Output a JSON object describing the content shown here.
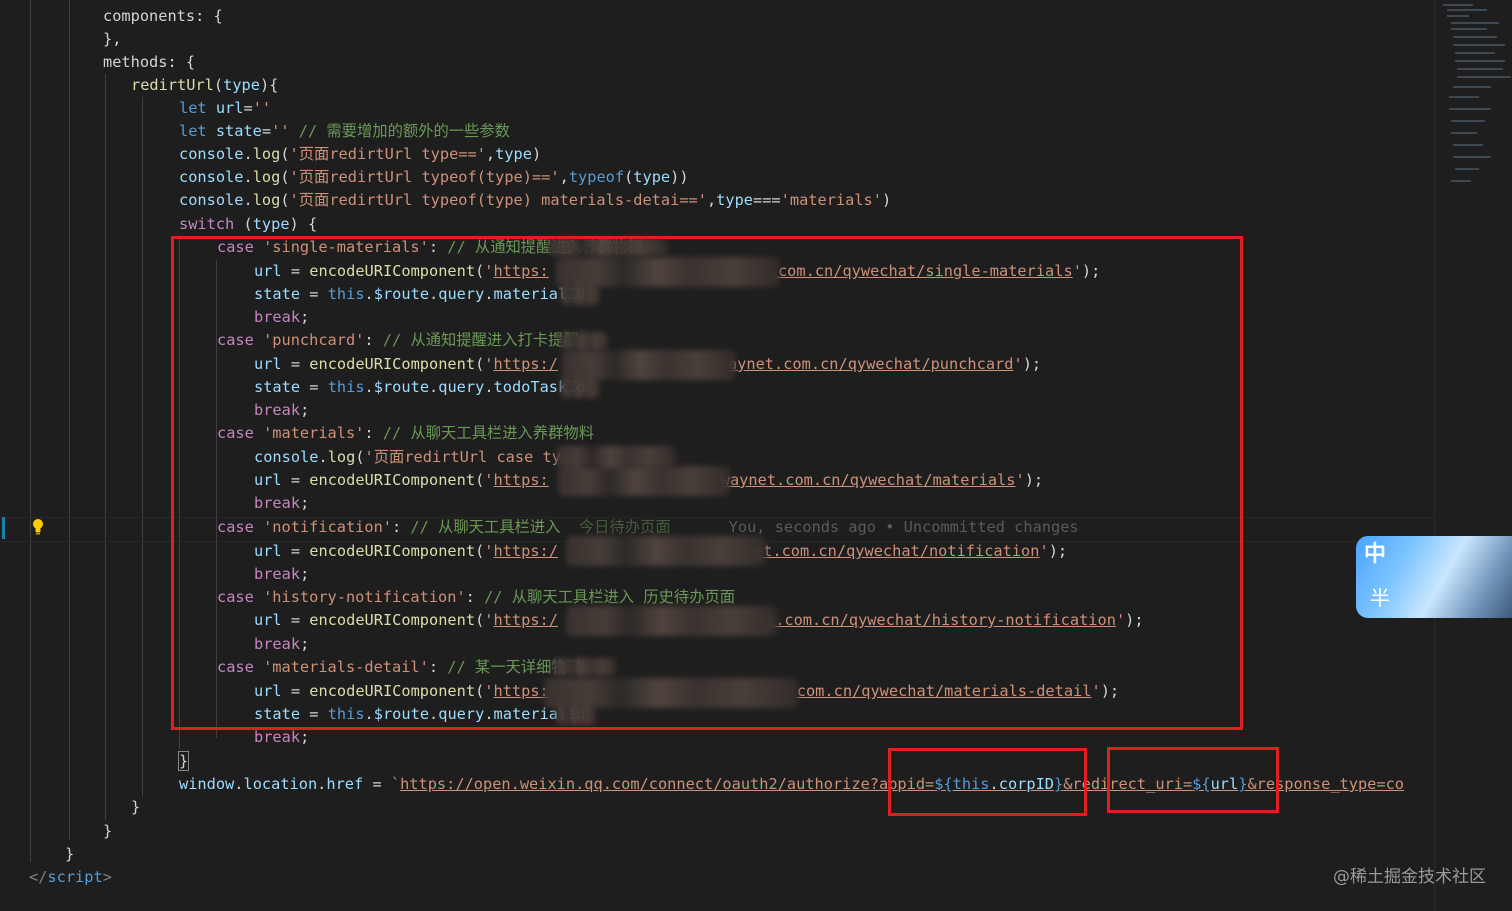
{
  "colors": {
    "background": "#1e1e1e",
    "keyword": "#569cd6",
    "control": "#c586c0",
    "function": "#dcdcaa",
    "variable": "#9cdcfe",
    "string": "#ce9178",
    "comment": "#6a9955",
    "highlight_box": "#e02020"
  },
  "icons": {
    "lightbulb": "lightbulb-icon",
    "ime": "ime-indicator-icon"
  },
  "lines": {
    "l1": {
      "a": "components: {"
    },
    "l2": {
      "a": "},"
    },
    "l3": {
      "a": "methods: {"
    },
    "l4": {
      "f": "redirtUrl",
      "p": "(",
      "v": "type",
      "e": "){"
    },
    "l5": {
      "k": "let ",
      "v": "url",
      "o": "=",
      "s": "''"
    },
    "l6": {
      "k": "let ",
      "v": "state",
      "o": "=",
      "s": "''",
      "c": " // 需要增加的额外的一些参数"
    },
    "l7": {
      "v": "console",
      "d": ".",
      "f": "log",
      "p": "(",
      "s": "'页面redirtUrl type=='",
      "m": ",",
      "v2": "type",
      "e": ")"
    },
    "l8": {
      "v": "console",
      "d": ".",
      "f": "log",
      "p": "(",
      "s": "'页面redirtUrl typeof(type)=='",
      "m": ",",
      "k": "typeof",
      "p2": "(",
      "v2": "type",
      "e": "))"
    },
    "l9": {
      "v": "console",
      "d": ".",
      "f": "log",
      "p": "(",
      "s": "'页面redirtUrl typeof(type) materials-detai=='",
      "m": ",",
      "v2": "type",
      "o": "===",
      "s2": "'materials'",
      "e": ")"
    },
    "l10": {
      "k": "switch",
      "p": " (",
      "v": "type",
      "e": ") {"
    },
    "l11": {
      "k": "case ",
      "s": "'single-materials'",
      "o": ": ",
      "c": "// 从通知提醒进入养群物料"
    },
    "l12": {
      "v": "url",
      "o": " = ",
      "f": "encodeURIComponent",
      "p": "(",
      "s": "'",
      "u1": "https:",
      "u2": ".com.cn/qywechat/single-materials",
      "s2": "'",
      "e": ");"
    },
    "l13": {
      "v": "state",
      "o": " = ",
      "k": "this",
      "d": ".",
      "v2": "$route",
      "d2": ".",
      "v3": "query",
      "d3": ".",
      "v4": "materialId"
    },
    "l14": {
      "k": "break",
      "e": ";"
    },
    "l15": {
      "k": "case ",
      "s": "'punchcard'",
      "o": ": ",
      "c": "// 从通知提醒进入打卡提醒"
    },
    "l16": {
      "v": "url",
      "o": " = ",
      "f": "encodeURIComponent",
      "p": "(",
      "s": "'",
      "u1": "https:/",
      "u2": "aynet.com.cn/qywechat/punchcard",
      "s2": "'",
      "e": ");"
    },
    "l17": {
      "v": "state",
      "o": " = ",
      "k": "this",
      "d": ".",
      "v2": "$route",
      "d2": ".",
      "v3": "query",
      "d3": ".",
      "v4": "todoTaskId"
    },
    "l18": {
      "k": "break",
      "e": ";"
    },
    "l19": {
      "k": "case ",
      "s": "'materials'",
      "o": ": ",
      "c": "// 从聊天工具栏进入养群物料"
    },
    "l20": {
      "v": "console",
      "d": ".",
      "f": "log",
      "p": "(",
      "s": "'页面redirtUrl case ty",
      "e": ""
    },
    "l21": {
      "v": "url",
      "o": " = ",
      "f": "encodeURIComponent",
      "p": "(",
      "s": "'",
      "u1": "https:",
      "u2": "waynet.com.cn/qywechat/materials",
      "s2": "'",
      "e": ");"
    },
    "l22": {
      "k": "break",
      "e": ";"
    },
    "l23": {
      "k": "case ",
      "s": "'notification'",
      "o": ": ",
      "c": "// 从聊天工具栏进入",
      "c2": "今日待办页面",
      "blame": "You, seconds ago • Uncommitted changes"
    },
    "l24": {
      "v": "url",
      "o": " = ",
      "f": "encodeURIComponent",
      "p": "(",
      "s": "'",
      "u1": "https:/",
      "u2": "et.com.cn/qywechat/notification",
      "s2": "'",
      "e": ");"
    },
    "l25": {
      "k": "break",
      "e": ";"
    },
    "l26": {
      "k": "case ",
      "s": "'history-notification'",
      "o": ": ",
      "c": "// 从聊天工具栏进入 历史待办页面"
    },
    "l27": {
      "v": "url",
      "o": " = ",
      "f": "encodeURIComponent",
      "p": "(",
      "s": "'",
      "u1": "https:/",
      "u2": "t.com.cn/qywechat/history-notification",
      "s2": "'",
      "e": ");"
    },
    "l28": {
      "k": "break",
      "e": ";"
    },
    "l29": {
      "k": "case ",
      "s": "'materials-detail'",
      "o": ": ",
      "c": "// 某一天详细物料"
    },
    "l30": {
      "v": "url",
      "o": " = ",
      "f": "encodeURIComponent",
      "p": "(",
      "s": "'",
      "u1": "https:",
      "u2": "com.cn/qywechat/materials-detail",
      "s2": "'",
      "e": ");"
    },
    "l31": {
      "v": "state",
      "o": " = ",
      "k": "this",
      "d": ".",
      "v2": "$route",
      "d2": ".",
      "v3": "query",
      "d3": ".",
      "v4": "materialId"
    },
    "l32": {
      "k": "break",
      "e": ";"
    },
    "l33": {
      "a": "}"
    },
    "l34": {
      "v": "window",
      "d": ".",
      "v2": "location",
      "d2": ".",
      "v3": "href",
      "o": " = ",
      "s": "`",
      "u1": "https://open.weixin.qq.com/connect/oauth2/authorize?appid=",
      "t1": "${",
      "k": "this",
      "d3": ".",
      "v4": "corpID",
      "t2": "}",
      "u2": "&redirect_uri=",
      "t3": "${",
      "v5": "url",
      "t4": "}",
      "u3": "&response_type=co"
    },
    "l35": {
      "a": "}"
    },
    "l36": {
      "a": "}"
    },
    "l37": {
      "a": "}"
    },
    "l38": {
      "t": "</",
      "n": "script",
      "t2": ">"
    }
  },
  "ime": {
    "line1": "中",
    "line2": "半"
  },
  "watermark": "@稀土掘金技术社区"
}
